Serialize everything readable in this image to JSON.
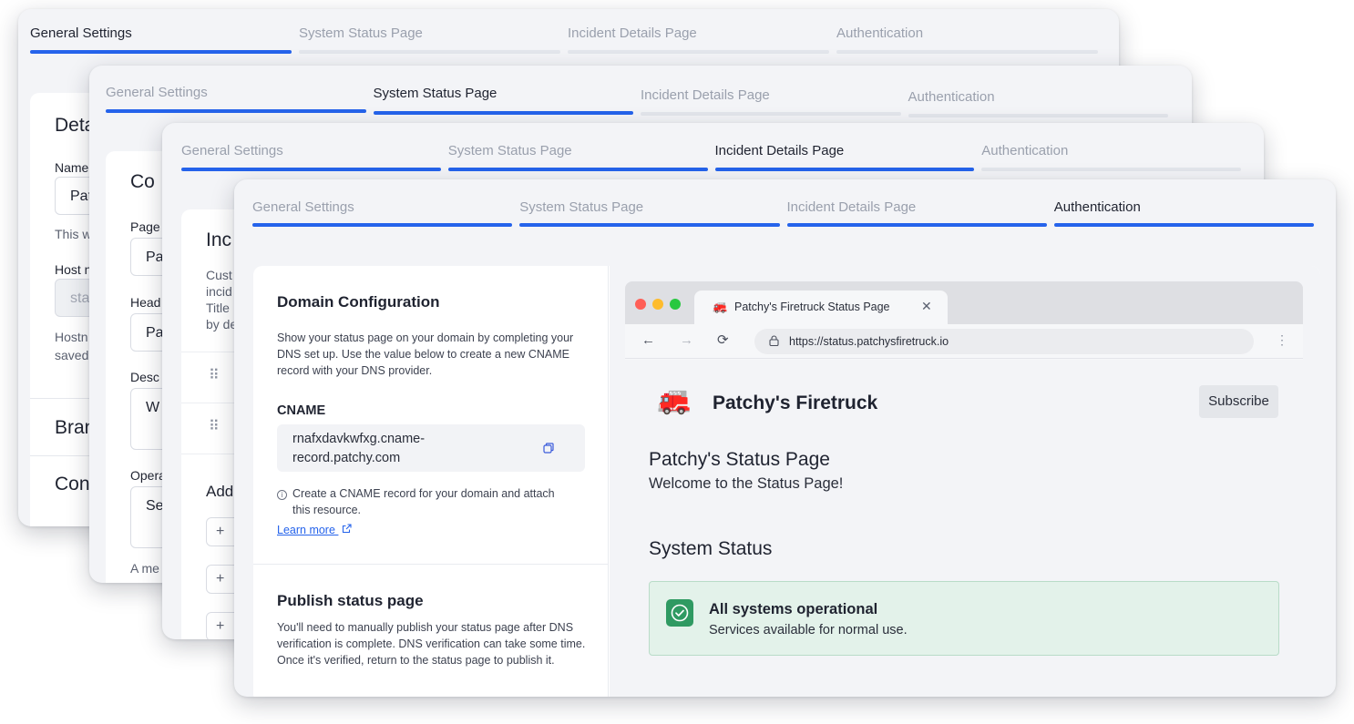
{
  "tabs": [
    "General Settings",
    "System Status Page",
    "Incident Details Page",
    "Authentication"
  ],
  "card1": {
    "heading_partial": "Deta",
    "name_label": "Name",
    "name_value": "Pat",
    "helper": "This w",
    "host_label": "Host n",
    "host_value": "sta",
    "hostname_note": [
      "Hostn",
      "saved"
    ],
    "section_brand": "Bran",
    "section_con": "Con"
  },
  "card2": {
    "heading_partial": "Co",
    "page_label": "Page",
    "page_value": "Pa",
    "header_label": "Head",
    "header_value": "Pa",
    "desc_label": "Desc",
    "desc_value": "W",
    "oper_label": "Opera",
    "oper_value": "Se",
    "footnote": "A me"
  },
  "card3": {
    "heading_partial": "Inc",
    "intro": [
      "Cust",
      "incid",
      "Title",
      "by de"
    ],
    "add_partial": "Add"
  },
  "card4": {
    "domain_title": "Domain Configuration",
    "domain_desc": "Show your status page on your domain by completing your DNS set up. Use the value below to create a new CNAME record with your DNS provider.",
    "cname_label": "CNAME",
    "cname_value_line1": "rnafxdavkwfxg.cname-",
    "cname_value_line2": "record.patchy.com",
    "cname_note": "Create a CNAME record for your domain and attach this resource.",
    "learn_more": "Learn more",
    "publish_title": "Publish status page",
    "publish_desc": "You'll need to manually publish your status page after DNS verification is complete. DNS verification can take some time. Once it's verified, return to the status page to publish it."
  },
  "preview": {
    "tab_title": "Patchy's Firetruck Status Page",
    "url_prefix": "https://",
    "url_host": "status.patchysfiretruck.io",
    "brand": "Patchy's Firetruck",
    "subscribe": "Subscribe",
    "page_title": "Patchy's Status Page",
    "welcome": "Welcome to the Status Page!",
    "system_status": "System Status",
    "status_title": "All systems operational",
    "status_sub": "Services available for normal use."
  },
  "colors": {
    "accent": "#2563eb",
    "success_bg": "#e3f2ea",
    "success_border": "#b9dcc8",
    "success_icon": "#2f9a62"
  }
}
